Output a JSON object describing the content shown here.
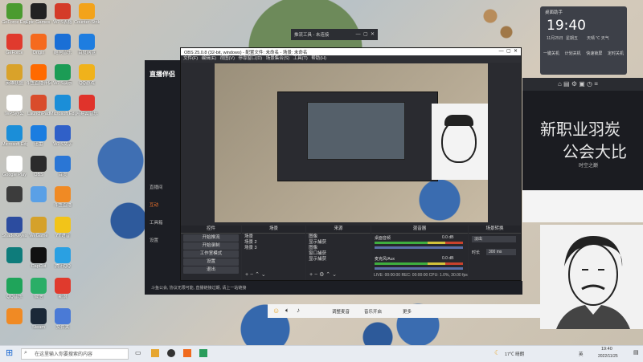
{
  "desktop_icons": [
    {
      "label": "GeForce Experience",
      "color": "#4b9b2f"
    },
    {
      "label": "GeForce",
      "color": "#e03a2d"
    },
    {
      "label": "英雄联盟",
      "color": "#d9a22a"
    },
    {
      "label": "WPS办公",
      "color": "#ffffff"
    },
    {
      "label": "Microsoft Edge",
      "color": "#1b8ed8"
    },
    {
      "label": "Google Play",
      "color": "#ffffff"
    },
    {
      "label": "",
      "color": "#3c3c3c"
    },
    {
      "label": "ShadeKeyes",
      "color": "#2c4c9f"
    },
    {
      "label": "",
      "color": "#0e7c7b"
    },
    {
      "label": "QQ音乐",
      "color": "#1fa45a"
    },
    {
      "label": "",
      "color": "#f08a24"
    },
    {
      "label": "Epic Games Launcher",
      "color": "#222222"
    },
    {
      "label": "Origin",
      "color": "#f56a1e"
    },
    {
      "label": "斗鱼直播伴侣",
      "color": "#ff6a00"
    },
    {
      "label": "LaunchPad",
      "color": "#d94c2b"
    },
    {
      "label": "迅雷",
      "color": "#1b7de0"
    },
    {
      "label": "OBS",
      "color": "#2b2b2b"
    },
    {
      "label": "",
      "color": "#5aa0e6"
    },
    {
      "label": "WeGame",
      "color": "#d5a12a"
    },
    {
      "label": "CapCut",
      "color": "#111111"
    },
    {
      "label": "微信",
      "color": "#2aae67"
    },
    {
      "label": "Steam",
      "color": "#1b2838"
    },
    {
      "label": "WPS表格",
      "color": "#d43b28"
    },
    {
      "label": "酷狗音乐",
      "color": "#1a6fd6"
    },
    {
      "label": "WPS演示",
      "color": "#1b9c55"
    },
    {
      "label": "Microsoft Edge",
      "color": "#1b8ed8"
    },
    {
      "label": "WPS文字",
      "color": "#3060c8"
    },
    {
      "label": "百度",
      "color": "#2a76d5"
    },
    {
      "label": "斗鱼直播",
      "color": "#f08a24"
    },
    {
      "label": "YY语音",
      "color": "#f2c419"
    },
    {
      "label": "腾讯QQ",
      "color": "#2aa0e2"
    },
    {
      "label": "新浪",
      "color": "#e03a2d"
    },
    {
      "label": "文件夹",
      "color": "#4a7ad6"
    },
    {
      "label": "Counter-Strike Global",
      "color": "#f3a31b"
    },
    {
      "label": "百度网盘",
      "color": "#1e7de0"
    },
    {
      "label": "QQ游戏",
      "color": "#f0b21b"
    },
    {
      "label": "网易云音乐",
      "color": "#e0332b"
    }
  ],
  "small_window": {
    "title": "推流工具 - 未连接",
    "controls": [
      "—",
      "▢",
      "✕"
    ]
  },
  "obs": {
    "title": "OBS 25.0.8 (32-bit, windows) - 配置文件: 未命名 - 场景: 未命名",
    "menu": [
      "文件(F)",
      "编辑(E)",
      "视图(V)",
      "停靠窗口(D)",
      "场景集合(S)",
      "工具(T)",
      "帮助(H)"
    ],
    "panels": {
      "controls": "控件",
      "scenes": "场景",
      "sources": "来源",
      "mixer": "混音器",
      "transitions": "场景转换"
    },
    "buttons": [
      "开始推流",
      "开始录制",
      "工作室模式",
      "设置",
      "退出"
    ],
    "scenes": [
      "场景",
      "场景 2",
      "场景 3"
    ],
    "sources": [
      "图像",
      "显示捕获",
      "图像",
      "窗口捕获",
      "显示捕获"
    ],
    "mixer": [
      {
        "name": "桌面音频",
        "level": "0.0 dB"
      },
      {
        "name": "麦克风/Aux",
        "level": "0.0 dB"
      }
    ],
    "transition": {
      "type": "淡出",
      "duration_label": "时长",
      "duration": "300 ms"
    },
    "status": "LIVE: 00:00:00   REC: 00:00:00   CPU: 1.0%, 30.00 fps"
  },
  "streamer": {
    "logo": "直播伴侣",
    "menu": [
      "直播间",
      "互动",
      "工具箱",
      "设置"
    ],
    "status": "斗鱼公会, 协议无限可能, 直播链接过期, 请上一站链接"
  },
  "right_panel": {
    "banner": "新职业羽炭",
    "banner2": "公会大比",
    "sub": "时空之巅"
  },
  "notification": {
    "title": "桌面助手",
    "time": "19:40",
    "date": "11月25日",
    "weekday": "星期五",
    "weather": "天晴 ℃ 天气",
    "items": [
      "一键关机",
      "计划关机",
      "快速锁屏",
      "定时关机"
    ]
  },
  "mic_bar": {
    "items": [
      "静音",
      "音量",
      "开麦",
      "摄像头",
      "设置"
    ],
    "button": "音乐开启",
    "settings": "调整麦音",
    "extra": "更多"
  },
  "taskbar": {
    "search_placeholder": "在这里输入你要搜索的内容",
    "temp": "17℃ 晴朗",
    "time": "19:40",
    "date": "2022/11/25",
    "lang": "英"
  }
}
